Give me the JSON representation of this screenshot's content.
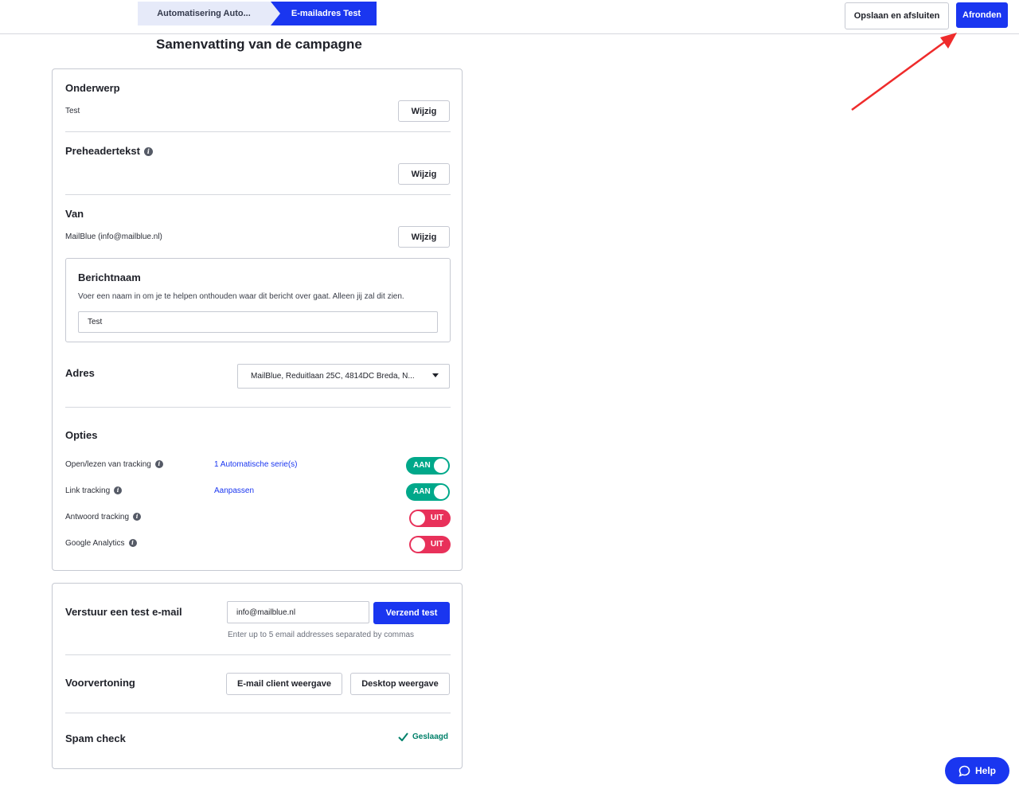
{
  "header": {
    "breadcrumbs": [
      "Automatisering Auto...",
      "E-mailadres Test"
    ],
    "save_exit_label": "Opslaan en afsluiten",
    "finish_label": "Afronden"
  },
  "page_title": "Samenvatting van de campagne",
  "summary": {
    "subject": {
      "title": "Onderwerp",
      "value": "Test",
      "edit_label": "Wijzig"
    },
    "preheader": {
      "title": "Preheadertekst",
      "value": "",
      "edit_label": "Wijzig"
    },
    "from": {
      "title": "Van",
      "value": "MailBlue (info@mailblue.nl)",
      "edit_label": "Wijzig"
    },
    "message_name": {
      "title": "Berichtnaam",
      "description": "Voer een naam in om je te helpen onthouden waar dit bericht over gaat. Alleen jij zal dit zien.",
      "value": "Test"
    },
    "address": {
      "title": "Adres",
      "selected": "MailBlue, Reduitlaan 25C, 4814DC Breda, N..."
    },
    "options": {
      "title": "Opties",
      "rows": [
        {
          "label": "Open/lezen van tracking",
          "link": "1 Automatische serie(s)",
          "state": "AAN",
          "on": true
        },
        {
          "label": "Link tracking",
          "link": "Aanpassen",
          "state": "AAN",
          "on": true
        },
        {
          "label": "Antwoord tracking",
          "link": "",
          "state": "UIT",
          "on": false
        },
        {
          "label": "Google Analytics",
          "link": "",
          "state": "UIT",
          "on": false
        }
      ]
    }
  },
  "test_email": {
    "title": "Verstuur een test e-mail",
    "value": "info@mailblue.nl",
    "send_label": "Verzend test",
    "hint": "Enter up to 5 email addresses separated by commas"
  },
  "preview": {
    "title": "Voorvertoning",
    "client_label": "E-mail client weergave",
    "desktop_label": "Desktop weergave"
  },
  "spam": {
    "title": "Spam check",
    "status": "Geslaagd"
  },
  "help_label": "Help",
  "colors": {
    "primary": "#1a36f0",
    "on": "#00a88a",
    "off": "#e8315a",
    "annotation": "#ef2b2b"
  }
}
